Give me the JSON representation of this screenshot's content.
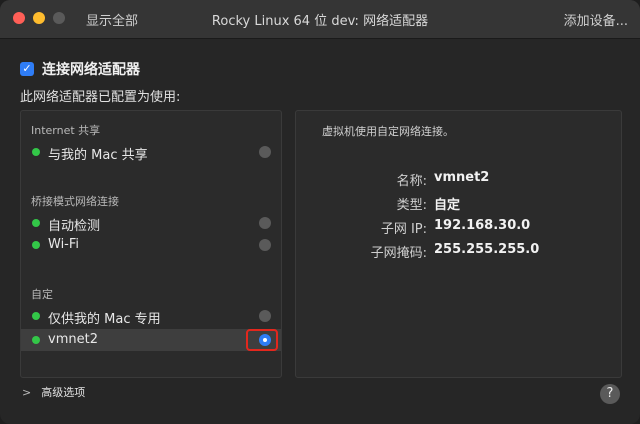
{
  "titlebar": {
    "show_all": "显示全部",
    "title": "Rocky Linux 64 位 dev: 网络适配器",
    "add_device": "添加设备..."
  },
  "connect": {
    "checked": true,
    "label": "连接网络适配器"
  },
  "config_label": "此网络适配器已配置为使用:",
  "list": {
    "groups": [
      {
        "title": "Internet 共享",
        "items": [
          {
            "label": "与我的 Mac 共享",
            "selected": false
          }
        ]
      },
      {
        "title": "桥接模式网络连接",
        "items": [
          {
            "label": "自动检测",
            "selected": false
          },
          {
            "label": "Wi-Fi",
            "selected": false
          }
        ]
      },
      {
        "title": "自定",
        "items": [
          {
            "label": "仅供我的 Mac 专用",
            "selected": false
          },
          {
            "label": "vmnet2",
            "selected": true
          }
        ]
      }
    ]
  },
  "details": {
    "description": "虚拟机使用自定网络连接。",
    "rows": [
      {
        "key": "名称:",
        "value": "vmnet2"
      },
      {
        "key": "类型:",
        "value": "自定"
      },
      {
        "key": "子网 IP:",
        "value": "192.168.30.0"
      },
      {
        "key": "子网掩码:",
        "value": "255.255.255.0"
      }
    ]
  },
  "advanced_label": "高级选项",
  "help_label": "?",
  "colors": {
    "accent": "#2f7df6",
    "status_green": "#33c748",
    "highlight": "#e3271d"
  }
}
